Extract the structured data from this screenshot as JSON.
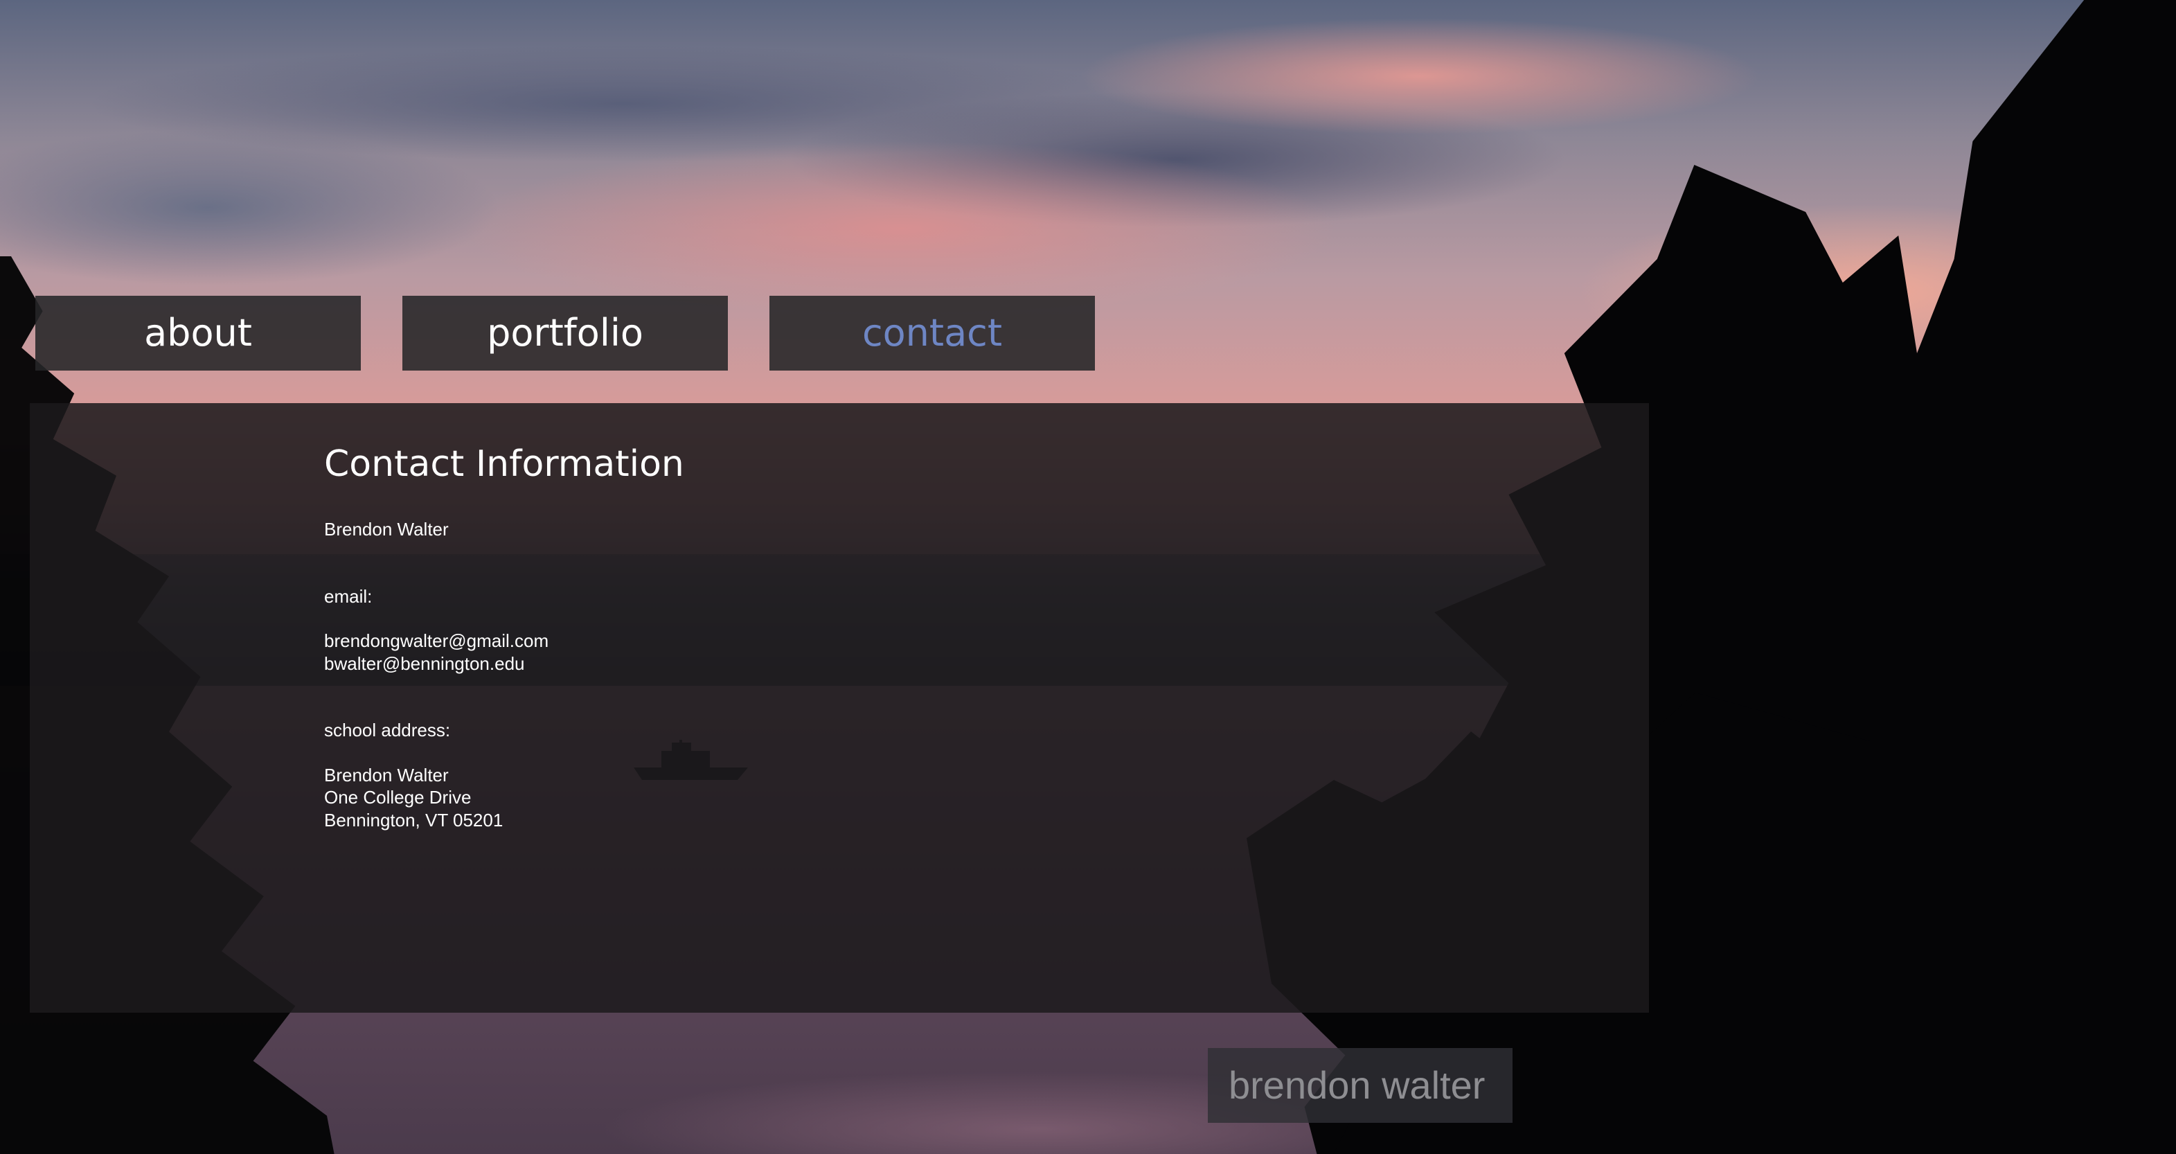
{
  "nav": {
    "items": [
      {
        "label": "about"
      },
      {
        "label": "portfolio"
      },
      {
        "label": "contact"
      }
    ],
    "active_color": "#6e86c4"
  },
  "content": {
    "title": "Contact Information",
    "name": "Brendon Walter",
    "email_label": "email:",
    "emails": [
      "brendongwalter@gmail.com",
      "bwalter@bennington.edu"
    ],
    "address_label": "school address:",
    "address_lines": [
      "Brendon Walter",
      "One College Drive",
      "Bennington, VT 05201"
    ]
  },
  "footer": {
    "brand": "brendon walter"
  }
}
